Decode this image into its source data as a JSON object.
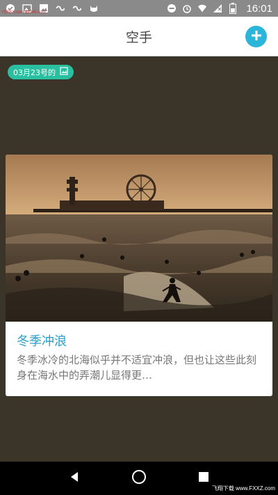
{
  "status_bar": {
    "time": "16:01",
    "watermark": "YESKY.com 92345.com",
    "icons_left": [
      "check-icon",
      "gallery-icon",
      "image-icon",
      "link-icon",
      "link-icon",
      "cat-icon"
    ],
    "icons_right": [
      "dnd-icon",
      "alarm-icon",
      "wifi-icon",
      "signal-icon",
      "battery-icon"
    ]
  },
  "app_bar": {
    "title": "空手",
    "add_icon": "plus-icon"
  },
  "date_tag": {
    "label": "03月23号的",
    "icon": "image-icon"
  },
  "card": {
    "title": "冬季冲浪",
    "description": "冬季冰冷的北海似乎并不适宜冲浪，但也让这些此刻身在海水中的弄潮儿显得更…"
  },
  "nav_bar": {
    "buttons": [
      "back-icon",
      "home-icon",
      "recents-icon"
    ],
    "brand": "飞翔下载 www.FXXZ.com"
  },
  "colors": {
    "accent": "#2bb5d9",
    "tag": "#28c0a0",
    "background": "#3b3529",
    "title_text": "#2aa0c4"
  }
}
